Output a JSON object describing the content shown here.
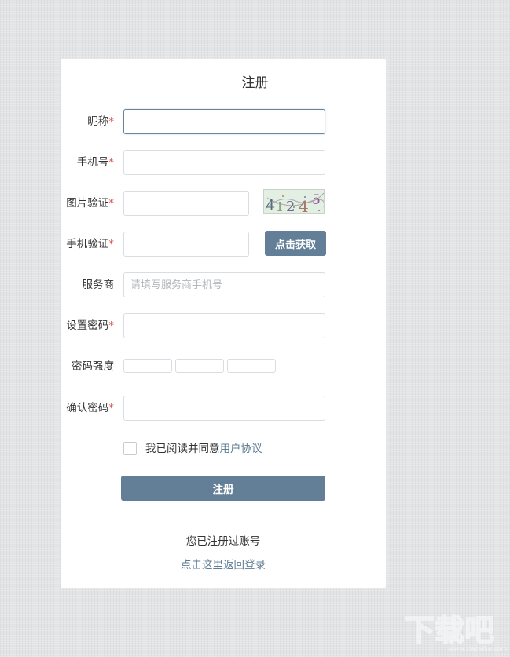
{
  "form": {
    "title": "注册",
    "fields": {
      "nickname": {
        "label": "昵称",
        "required_mark": "*",
        "value": ""
      },
      "phone": {
        "label": "手机号",
        "required_mark": "*",
        "value": ""
      },
      "image_code": {
        "label": "图片验证",
        "required_mark": "*",
        "value": "",
        "captcha_text": "41245"
      },
      "sms_code": {
        "label": "手机验证",
        "required_mark": "*",
        "value": "",
        "button_label": "点击获取"
      },
      "provider": {
        "label": "服务商",
        "placeholder": "请填写服务商手机号",
        "value": ""
      },
      "password": {
        "label": "设置密码",
        "required_mark": "*",
        "value": ""
      },
      "strength": {
        "label": "密码强度",
        "level": 0
      },
      "confirm": {
        "label": "确认密码",
        "required_mark": "*",
        "value": ""
      }
    },
    "agreement": {
      "checked": false,
      "text": "我已阅读并同意",
      "link": "用户协议"
    },
    "submit_label": "注册",
    "already_registered": "您已注册过账号",
    "back_to_login": "点击这里返回登录"
  },
  "watermark": {
    "text": "下载吧",
    "url_text": "www.xiazaiba.com"
  },
  "colors": {
    "accent": "#637f97",
    "link": "#5e7d95",
    "required": "#d9534f",
    "background": "#e2e4e6",
    "card": "#ffffff"
  }
}
